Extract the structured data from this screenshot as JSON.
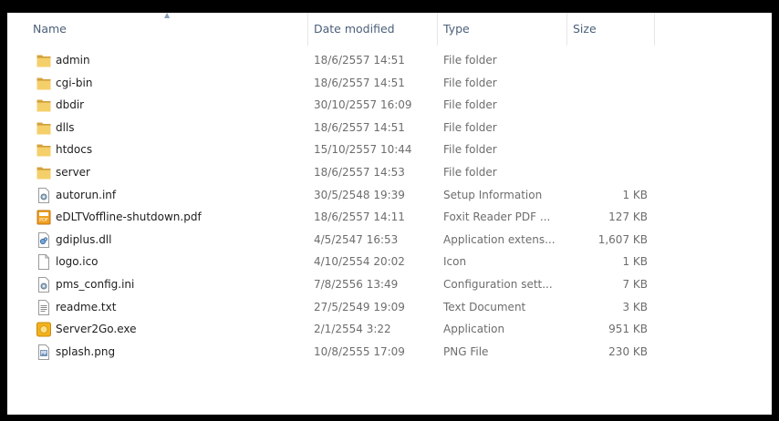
{
  "columns": {
    "name": "Name",
    "date": "Date modified",
    "type": "Type",
    "size": "Size"
  },
  "sort": {
    "column": "Name",
    "arrow": "▲"
  },
  "files": [
    {
      "icon": "folder-icon",
      "name": "admin",
      "date": "18/6/2557 14:51",
      "type": "File folder",
      "size": ""
    },
    {
      "icon": "folder-icon",
      "name": "cgi-bin",
      "date": "18/6/2557 14:51",
      "type": "File folder",
      "size": ""
    },
    {
      "icon": "folder-icon",
      "name": "dbdir",
      "date": "30/10/2557 16:09",
      "type": "File folder",
      "size": ""
    },
    {
      "icon": "folder-icon",
      "name": "dlls",
      "date": "18/6/2557 14:51",
      "type": "File folder",
      "size": ""
    },
    {
      "icon": "folder-icon",
      "name": "htdocs",
      "date": "15/10/2557 10:44",
      "type": "File folder",
      "size": ""
    },
    {
      "icon": "folder-icon",
      "name": "server",
      "date": "18/6/2557 14:53",
      "type": "File folder",
      "size": ""
    },
    {
      "icon": "settings-file-icon",
      "name": "autorun.inf",
      "date": "30/5/2548 19:39",
      "type": "Setup Information",
      "size": "1 KB"
    },
    {
      "icon": "pdf-file-icon",
      "name": "eDLTVoffline-shutdown.pdf",
      "date": "18/6/2557 14:11",
      "type": "Foxit Reader PDF ...",
      "size": "127 KB"
    },
    {
      "icon": "dll-file-icon",
      "name": "gdiplus.dll",
      "date": "4/5/2547 16:53",
      "type": "Application extens...",
      "size": "1,607 KB"
    },
    {
      "icon": "blank-file-icon",
      "name": "logo.ico",
      "date": "4/10/2554 20:02",
      "type": "Icon",
      "size": "1 KB"
    },
    {
      "icon": "settings-file-icon",
      "name": "pms_config.ini",
      "date": "7/8/2556 13:49",
      "type": "Configuration sett...",
      "size": "7 KB"
    },
    {
      "icon": "text-file-icon",
      "name": "readme.txt",
      "date": "27/5/2549 19:09",
      "type": "Text Document",
      "size": "3 KB"
    },
    {
      "icon": "exe-app-icon",
      "name": "Server2Go.exe",
      "date": "2/1/2554 3:22",
      "type": "Application",
      "size": "951 KB"
    },
    {
      "icon": "image-file-icon",
      "name": "splash.png",
      "date": "10/8/2555 17:09",
      "type": "PNG File",
      "size": "230 KB"
    }
  ]
}
